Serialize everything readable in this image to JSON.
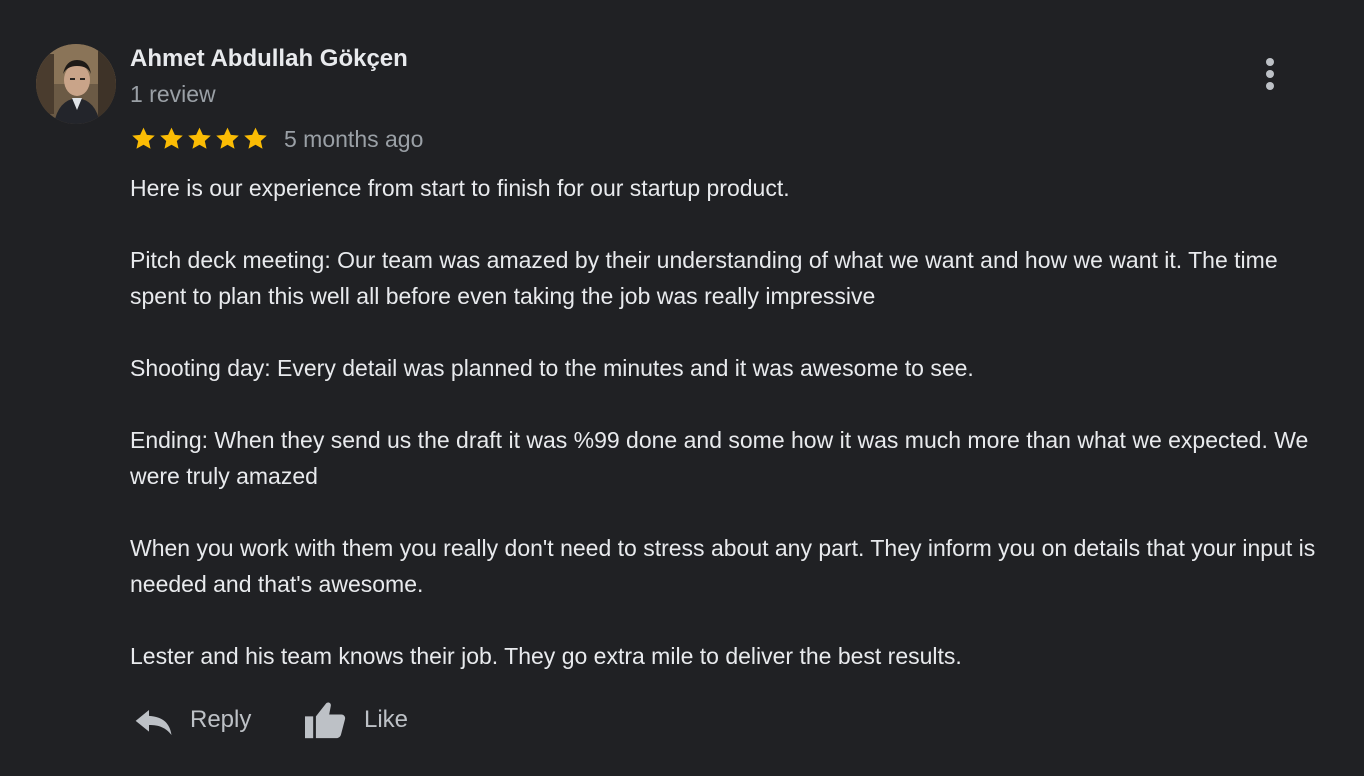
{
  "author": {
    "name": "Ahmet Abdullah Gökçen",
    "review_count": "1 review"
  },
  "rating": {
    "stars": 5,
    "max_stars": 5,
    "star_color": "#fbbc04",
    "time_ago": "5 months ago"
  },
  "review": {
    "paragraphs": [
      "Here is our experience from start to finish for our startup product.",
      "Pitch deck meeting: Our team was amazed by their understanding of what we want and how we want it. The time spent to plan this well all before even taking the job was really impressive",
      "Shooting day: Every detail was planned to the minutes and it was awesome to see.",
      "Ending: When they send us the draft it was %99 done and some how it was much more than what we expected. We were truly amazed",
      "When you work with them you really don't need to stress about any part. They inform you on details that your input is needed and that's awesome.",
      "Lester and his team knows their job. They go extra mile to deliver the best results."
    ]
  },
  "actions": {
    "reply_label": "Reply",
    "like_label": "Like"
  },
  "icons": {
    "more": "more-vert-icon",
    "reply": "reply-icon",
    "like": "thumb-up-icon"
  },
  "colors": {
    "background": "#202124",
    "primary_text": "#e8eaed",
    "secondary_text": "#9aa0a6"
  }
}
